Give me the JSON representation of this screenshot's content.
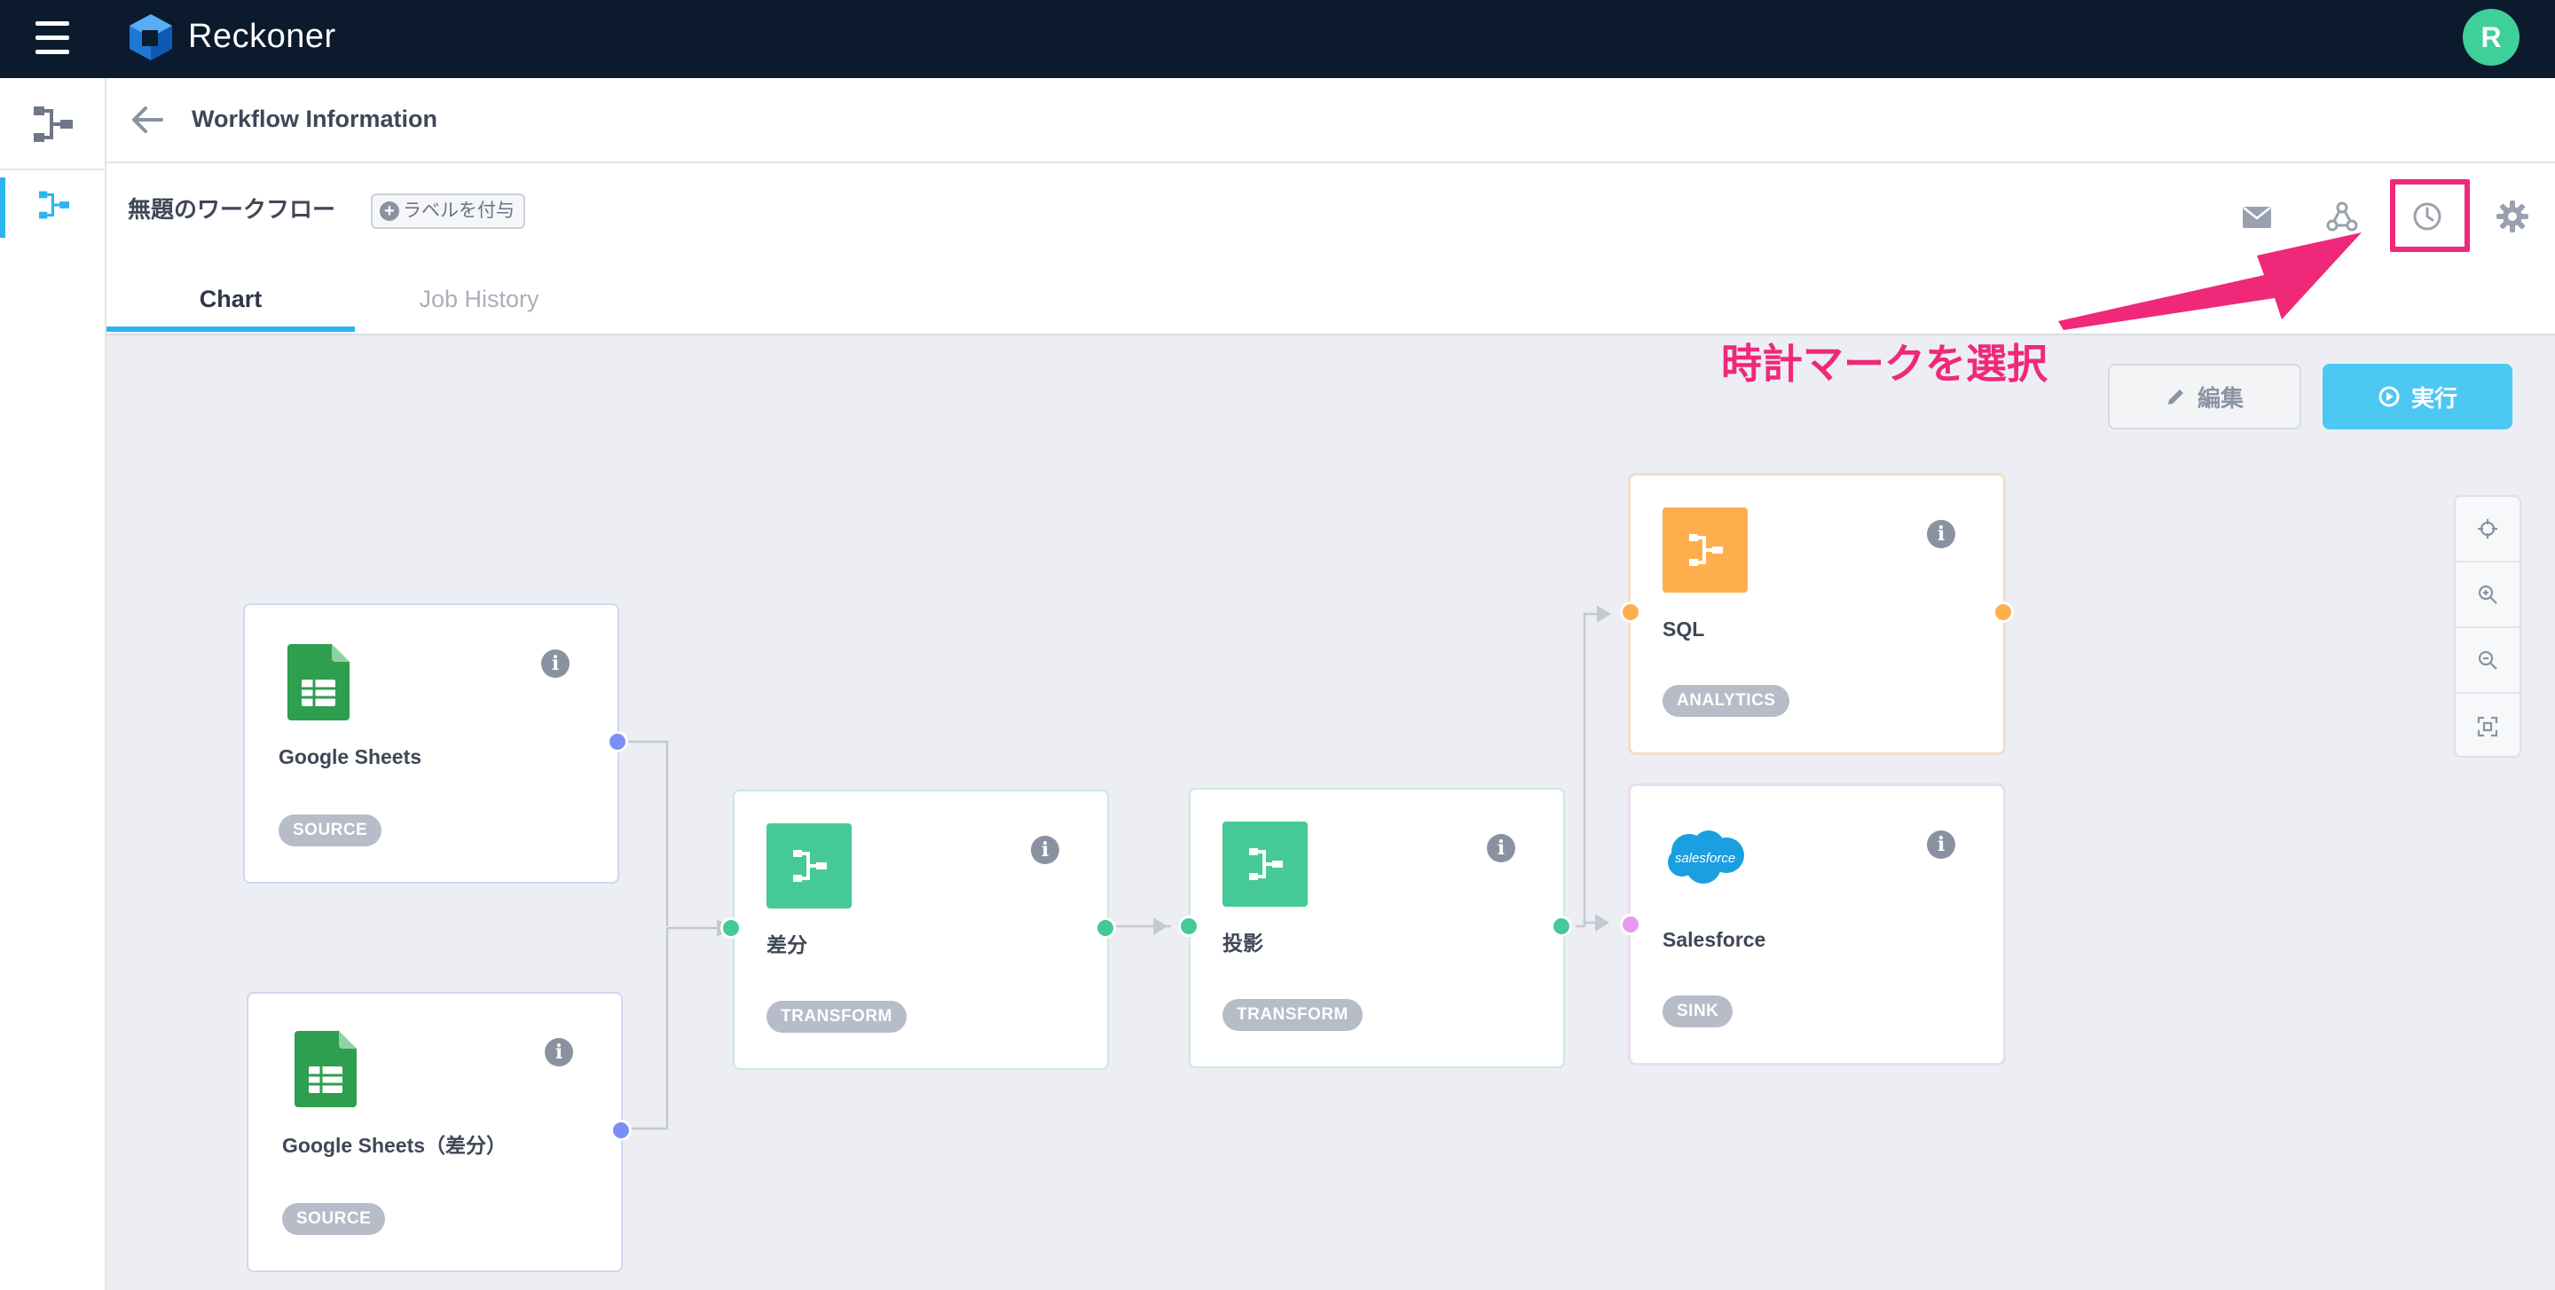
{
  "app": {
    "title": "Reckoner",
    "avatar_initial": "R"
  },
  "header": {
    "title": "Workflow Information"
  },
  "workflow": {
    "name": "無題のワークフロー",
    "label_button": "ラベルを付与"
  },
  "tabs": [
    {
      "label": "Chart",
      "active": true
    },
    {
      "label": "Job History",
      "active": false
    }
  ],
  "actions": {
    "edit_label": "編集",
    "run_label": "実行"
  },
  "annotation": {
    "text": "時計マークを選択",
    "color": "#f0287a"
  },
  "toolbar_icons": [
    "mail-icon",
    "webhook-icon",
    "clock-icon",
    "gear-icon"
  ],
  "zoom_controls": [
    "crosshair-icon",
    "zoom-in-icon",
    "zoom-out-icon",
    "fit-screen-icon"
  ],
  "nodes": [
    {
      "id": "google-sheets",
      "label": "Google Sheets",
      "tag": "SOURCE",
      "icon": "google-sheets-icon"
    },
    {
      "id": "google-sheets-diff",
      "label": "Google Sheets（差分）",
      "tag": "SOURCE",
      "icon": "google-sheets-icon"
    },
    {
      "id": "diff",
      "label": "差分",
      "tag": "TRANSFORM",
      "icon": "transform-icon"
    },
    {
      "id": "projection",
      "label": "投影",
      "tag": "TRANSFORM",
      "icon": "transform-icon"
    },
    {
      "id": "sql",
      "label": "SQL",
      "tag": "ANALYTICS",
      "icon": "analytics-icon"
    },
    {
      "id": "salesforce",
      "label": "Salesforce",
      "tag": "SINK",
      "icon": "salesforce-icon",
      "logo_text": "salesforce"
    }
  ],
  "colors": {
    "topbar": "#0b1a2c",
    "accent": "#2bb5f0",
    "run_button": "#4cc8f3",
    "transform": "#45c997",
    "analytics": "#ffae4d",
    "source_port": "#7a8ef5",
    "sink_port": "#e79af2",
    "avatar": "#3fcf9a"
  }
}
